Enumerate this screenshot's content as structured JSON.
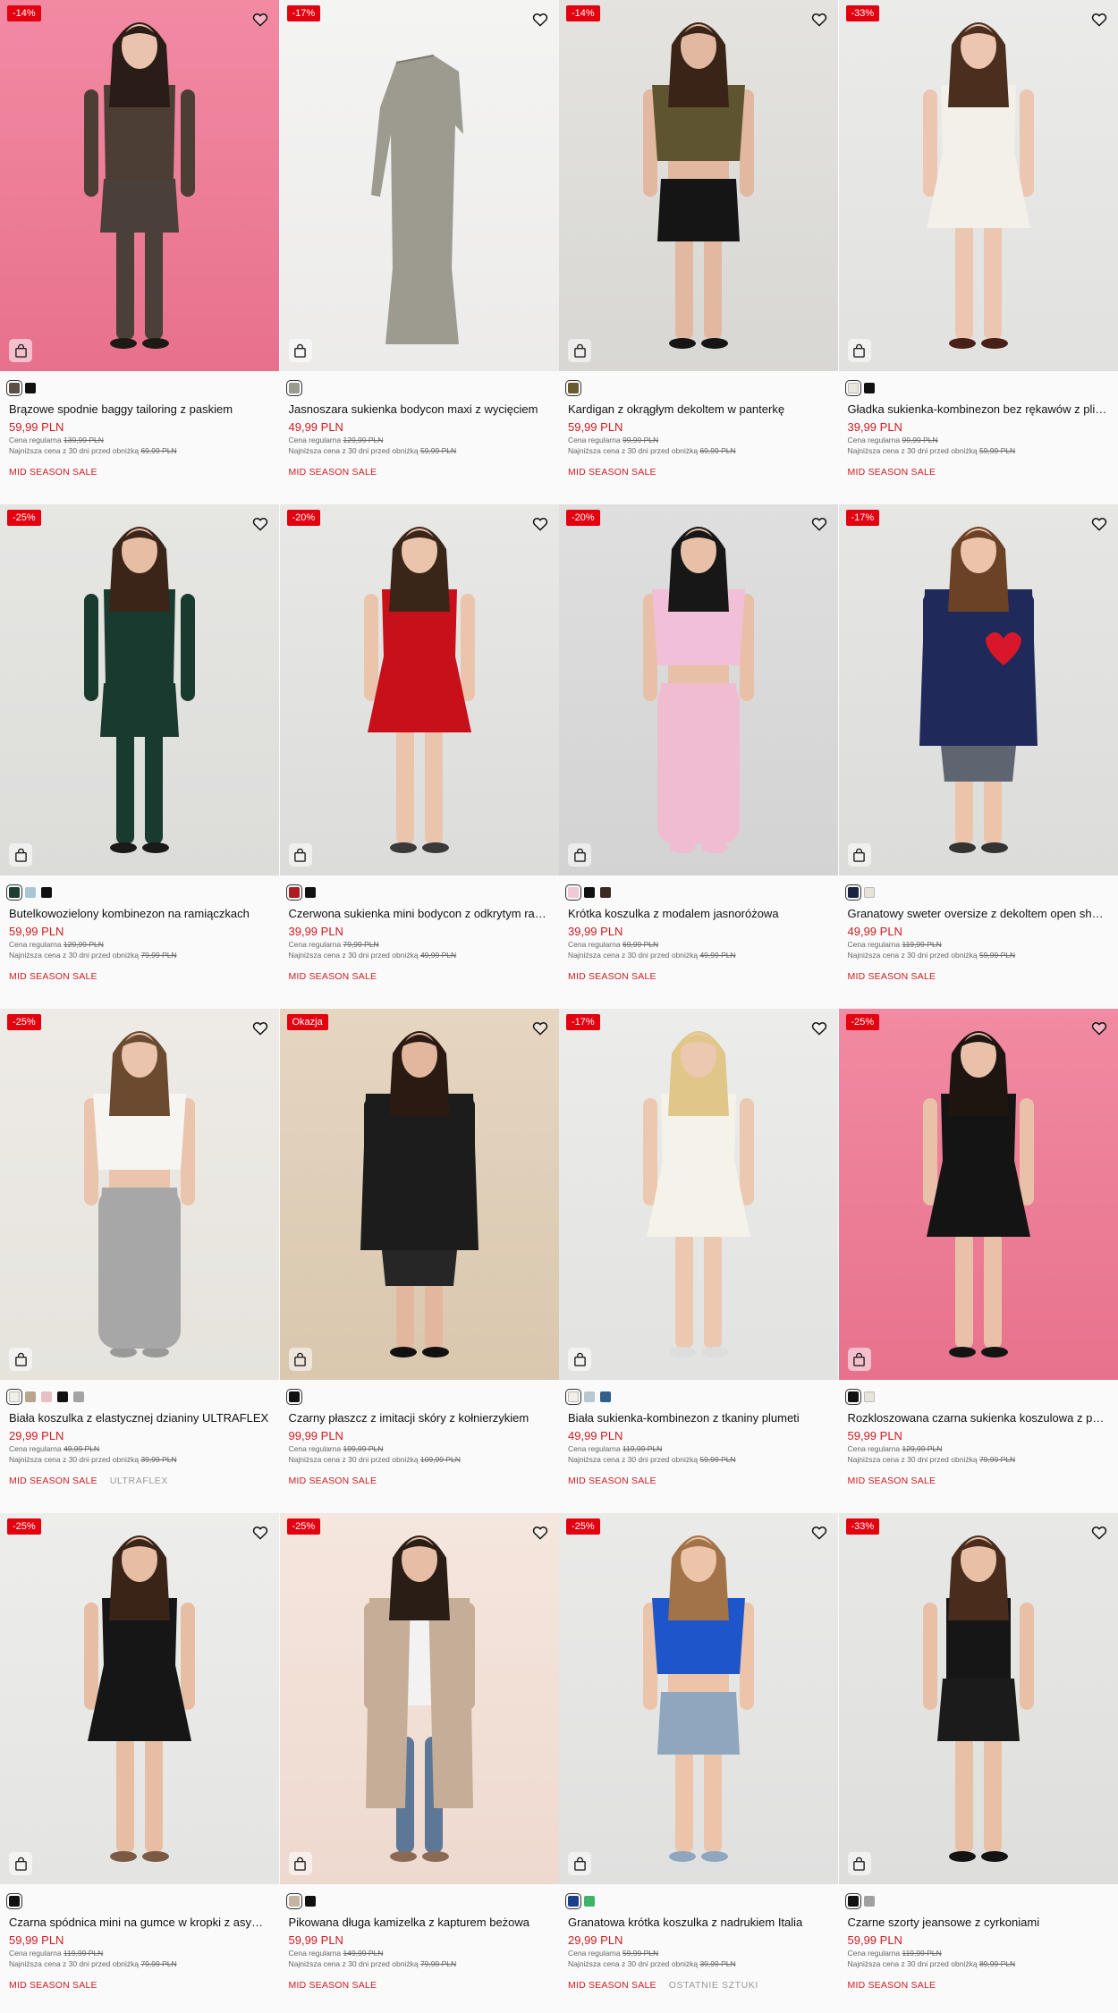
{
  "colors": {
    "sale_red": "#e3000f",
    "price_red": "#d01c22",
    "okazja_red": "#e3000f"
  },
  "icons": {
    "wishlist": "heart-outline-icon",
    "quick_add": "shopping-bag-icon"
  },
  "products": [
    {
      "badge": "-14%",
      "name": "Brązowe spodnie baggy tailoring z paskiem",
      "price": "59,99 PLN",
      "regular_label": "Cena regularna",
      "regular_price": "139,99 PLN",
      "lowest_label": "Najniższa cena z 30 dni przed obniżką",
      "lowest_price": "69,99 PLN",
      "tags": [
        "MID SEASON SALE"
      ],
      "swatches": [
        "#5b4f47",
        "#111111"
      ],
      "photo": {
        "bg": "#e8718d",
        "bg2": "#f28aa3",
        "skin": "#e9c3ad",
        "hair": "#2a1c16",
        "top": "#4c3e34",
        "bottom": "#4a3f39",
        "shoe": "#1e1915",
        "kind": "pants"
      }
    },
    {
      "badge": "-17%",
      "name": "Jasnoszara sukienka bodycon maxi z wycięciem",
      "price": "49,99 PLN",
      "regular_label": "Cena regularna",
      "regular_price": "129,99 PLN",
      "lowest_label": "Najniższa cena z 30 dni przed obniżką",
      "lowest_price": "59,99 PLN",
      "tags": [
        "MID SEASON SALE"
      ],
      "swatches": [
        "#9a9a90"
      ],
      "photo": {
        "bg": "#ecebea",
        "bg2": "#f4f4f3",
        "kind": "flat-dress",
        "dress": "#9d9b8f"
      }
    },
    {
      "badge": "-14%",
      "name": "Kardigan z okrągłym dekoltem w panterkę",
      "price": "59,99 PLN",
      "regular_label": "Cena regularna",
      "regular_price": "99,99 PLN",
      "lowest_label": "Najniższa cena z 30 dni przed obniżką",
      "lowest_price": "69,99 PLN",
      "tags": [
        "MID SEASON SALE"
      ],
      "swatches": [
        "#6b5a2e"
      ],
      "photo": {
        "bg": "#d8d7d3",
        "bg2": "#e4e3df",
        "skin": "#e3b8a0",
        "hair": "#3a2418",
        "top": "#5f5430",
        "bottom": "#151515",
        "shoe": "#151515",
        "kind": "crop"
      }
    },
    {
      "badge": "-33%",
      "name": "Gładka sukienka-kombinezon bez rękawów z plisami",
      "price": "39,99 PLN",
      "regular_label": "Cena regularna",
      "regular_price": "99,99 PLN",
      "lowest_label": "Najniższa cena z 30 dni przed obniżką",
      "lowest_price": "59,99 PLN",
      "tags": [
        "MID SEASON SALE"
      ],
      "swatches": [
        "#ebe6dc",
        "#111111"
      ],
      "photo": {
        "bg": "#e1e1df",
        "bg2": "#ebebea",
        "skin": "#ecc6b0",
        "hair": "#4b2e1e",
        "top": "#f3f0ea",
        "bottom": "#f1eee8",
        "shoe": "#4a1f17",
        "kind": "mini"
      }
    },
    {
      "badge": "-25%",
      "name": "Butelkowozielony kombinezon na ramiączkach",
      "price": "59,99 PLN",
      "regular_label": "Cena regularna",
      "regular_price": "129,99 PLN",
      "lowest_label": "Najniższa cena z 30 dni przed obniżką",
      "lowest_price": "79,99 PLN",
      "tags": [
        "MID SEASON SALE"
      ],
      "swatches": [
        "#1f3d33",
        "#a9c6d6",
        "#111111"
      ],
      "photo": {
        "bg": "#dcdcd9",
        "bg2": "#e6e6e3",
        "skin": "#e7bda4",
        "hair": "#3b2519",
        "top": "#193a2f",
        "bottom": "#193a2f",
        "shoe": "#1a1a1a",
        "kind": "pants"
      }
    },
    {
      "badge": "-20%",
      "name": "Czerwona sukienka mini bodycon z odkrytym ramieniem",
      "price": "39,99 PLN",
      "regular_label": "Cena regularna",
      "regular_price": "79,99 PLN",
      "lowest_label": "Najniższa cena z 30 dni przed obniżką",
      "lowest_price": "49,99 PLN",
      "tags": [
        "MID SEASON SALE"
      ],
      "swatches": [
        "#b01b22",
        "#111111"
      ],
      "photo": {
        "bg": "#dcdcda",
        "bg2": "#e8e8e6",
        "skin": "#ebc4ac",
        "hair": "#3a2619",
        "top": "#c8101a",
        "bottom": "#c8101a",
        "shoe": "#3a3a3a",
        "kind": "mini"
      }
    },
    {
      "badge": "-20%",
      "name": "Krótka koszulka z modalem jasnoróżowa",
      "price": "39,99 PLN",
      "regular_label": "Cena regularna",
      "regular_price": "69,99 PLN",
      "lowest_label": "Najniższa cena z 30 dni przed obniżką",
      "lowest_price": "49,99 PLN",
      "tags": [
        "MID SEASON SALE"
      ],
      "swatches": [
        "#f0c9d4",
        "#111111",
        "#3a2a24"
      ],
      "photo": {
        "bg": "#d3d3d3",
        "bg2": "#dfdfdf",
        "skin": "#e8c0a8",
        "hair": "#171717",
        "top": "#f2bfd8",
        "bottom": "#f0bcd2",
        "shoe": "#f0bcd2",
        "kind": "tee"
      }
    },
    {
      "badge": "-17%",
      "name": "Granatowy sweter oversize z dekoltem open shoulder",
      "price": "49,99 PLN",
      "regular_label": "Cena regularna",
      "regular_price": "119,99 PLN",
      "lowest_label": "Najniższa cena z 30 dni przed obniżką",
      "lowest_price": "59,99 PLN",
      "tags": [
        "MID SEASON SALE"
      ],
      "swatches": [
        "#1c2340",
        "#e6e3da"
      ],
      "photo": {
        "bg": "#dcdcda",
        "bg2": "#e6e6e4",
        "skin": "#ecc4aa",
        "hair": "#6b4226",
        "top": "#1f2a5a",
        "bottom": "#5d6670",
        "shoe": "#333",
        "kind": "sweater"
      }
    },
    {
      "badge": "-25%",
      "name": "Biała koszulka z elastycznej dzianiny ULTRAFLEX",
      "price": "29,99 PLN",
      "regular_label": "Cena regularna",
      "regular_price": "49,99 PLN",
      "lowest_label": "Najniższa cena z 30 dni przed obniżką",
      "lowest_price": "39,99 PLN",
      "tags": [
        "MID SEASON SALE",
        "ULTRAFLEX"
      ],
      "swatches": [
        "#f1efea",
        "#b8a48f",
        "#e8bfc4",
        "#111111",
        "#a3a3a3"
      ],
      "photo": {
        "bg": "#e6e3dd",
        "bg2": "#eeebe6",
        "skin": "#eac4ac",
        "hair": "#6b4a30",
        "top": "#f7f5f2",
        "bottom": "#a7a7a7",
        "shoe": "#999",
        "kind": "sweats"
      }
    },
    {
      "badge": "Okazja",
      "name": "Czarny płaszcz z imitacji skóry z kołnierzykiem",
      "price": "99,99 PLN",
      "regular_label": "Cena regularna",
      "regular_price": "199,99 PLN",
      "lowest_label": "Najniższa cena z 30 dni przed obniżką",
      "lowest_price": "109,99 PLN",
      "tags": [
        "MID SEASON SALE"
      ],
      "swatches": [
        "#111111"
      ],
      "photo": {
        "bg": "#d9c7ae",
        "bg2": "#e6d6c1",
        "skin": "#e2b79d",
        "hair": "#2b1a12",
        "top": "#1c1c1c",
        "bottom": "#262626",
        "shoe": "#111",
        "kind": "coat"
      }
    },
    {
      "badge": "-17%",
      "name": "Biała sukienka-kombinezon z tkaniny plumeti",
      "price": "49,99 PLN",
      "regular_label": "Cena regularna",
      "regular_price": "119,99 PLN",
      "lowest_label": "Najniższa cena z 30 dni przed obniżką",
      "lowest_price": "59,99 PLN",
      "tags": [
        "MID SEASON SALE"
      ],
      "swatches": [
        "#f1efe8",
        "#b7c9cf",
        "#2f5f8a"
      ],
      "photo": {
        "bg": "#e2e2e0",
        "bg2": "#ececeb",
        "skin": "#edc8b0",
        "hair": "#e1c68a",
        "top": "#f5f2ea",
        "bottom": "#f5f2ea",
        "shoe": "#ddd",
        "kind": "mini"
      }
    },
    {
      "badge": "-25%",
      "name": "Rozkloszowana czarna sukienka koszulowa z paskiem",
      "price": "59,99 PLN",
      "regular_label": "Cena regularna",
      "regular_price": "129,99 PLN",
      "lowest_label": "Najniższa cena z 30 dni przed obniżką",
      "lowest_price": "79,99 PLN",
      "tags": [
        "MID SEASON SALE"
      ],
      "swatches": [
        "#111111",
        "#e8e4dc"
      ],
      "photo": {
        "bg": "#e8728d",
        "bg2": "#f18aa2",
        "skin": "#e8c1a8",
        "hair": "#1e1410",
        "top": "#141414",
        "bottom": "#141414",
        "shoe": "#141414",
        "kind": "mini"
      }
    },
    {
      "badge": "-25%",
      "name": "Czarna spódnica mini na gumce w kropki z asymetrycznym dołem",
      "price": "59,99 PLN",
      "regular_label": "Cena regularna",
      "regular_price": "119,99 PLN",
      "lowest_label": "Najniższa cena z 30 dni przed obniżką",
      "lowest_price": "79,99 PLN",
      "tags": [
        "MID SEASON SALE"
      ],
      "swatches": [
        "#111111"
      ],
      "photo": {
        "bg": "#e4e4e2",
        "bg2": "#ededec",
        "skin": "#e7bea4",
        "hair": "#3a2418",
        "top": "#161616",
        "bottom": "#1a1a1a",
        "shoe": "#7a5a44",
        "kind": "mini"
      }
    },
    {
      "badge": "-25%",
      "name": "Pikowana długa kamizelka z kapturem beżowa",
      "price": "59,99 PLN",
      "regular_label": "Cena regularna",
      "regular_price": "149,99 PLN",
      "lowest_label": "Najniższa cena z 30 dni przed obniżką",
      "lowest_price": "79,99 PLN",
      "tags": [
        "MID SEASON SALE"
      ],
      "swatches": [
        "#c3b5a1",
        "#111111"
      ],
      "photo": {
        "bg": "#eed9cf",
        "bg2": "#f5e6de",
        "skin": "#e6bda5",
        "hair": "#2a1d16",
        "top": "#c6ad97",
        "bottom": "#5d7897",
        "shoe": "#8a6a55",
        "kind": "vest"
      }
    },
    {
      "badge": "-25%",
      "name": "Granatowa krótka koszulka z nadrukiem Italia",
      "price": "29,99 PLN",
      "regular_label": "Cena regularna",
      "regular_price": "59,99 PLN",
      "lowest_label": "Najniższa cena z 30 dni przed obniżką",
      "lowest_price": "39,99 PLN",
      "tags": [
        "MID SEASON SALE",
        "OSTATNIE SZTUKI"
      ],
      "swatches": [
        "#1c3f8e",
        "#3fb36a"
      ],
      "photo": {
        "bg": "#e0e0df",
        "bg2": "#eaeae9",
        "skin": "#ecc4a9",
        "hair": "#a27349",
        "top": "#1e55c8",
        "bottom": "#8fa6bf",
        "shoe": "#8fa6bf",
        "kind": "crop"
      }
    },
    {
      "badge": "-33%",
      "name": "Czarne szorty jeansowe z cyrkoniami",
      "price": "59,99 PLN",
      "regular_label": "Cena regularna",
      "regular_price": "119,99 PLN",
      "lowest_label": "Najniższa cena z 30 dni przed obniżką",
      "lowest_price": "89,99 PLN",
      "tags": [
        "MID SEASON SALE"
      ],
      "swatches": [
        "#111111",
        "#a0a0a0"
      ],
      "photo": {
        "bg": "#dededc",
        "bg2": "#e8e8e6",
        "skin": "#e8c0a6",
        "hair": "#4a2c1d",
        "top": "#161616",
        "bottom": "#1b1b1b",
        "shoe": "#141414",
        "kind": "shorts"
      }
    }
  ]
}
